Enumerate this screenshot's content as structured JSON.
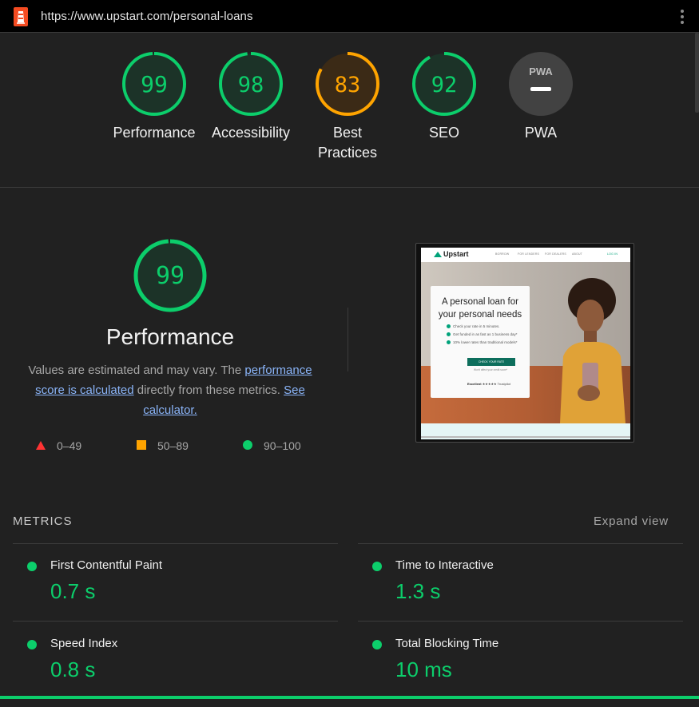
{
  "browser": {
    "url": "https://www.upstart.com/personal-loans",
    "menu_icon": "kebab-menu-icon",
    "logo_icon": "lighthouse-icon"
  },
  "colors": {
    "pass": "#0cce6b",
    "average": "#ffa400",
    "fail": "#ff3333",
    "background": "#212121",
    "link": "#8ab4f8"
  },
  "gauges": [
    {
      "score": 99,
      "label": "Performance",
      "status": "pass"
    },
    {
      "score": 98,
      "label": "Accessibility",
      "status": "pass"
    },
    {
      "score": 83,
      "label": "Best Practices",
      "status": "average"
    },
    {
      "score": 92,
      "label": "SEO",
      "status": "pass"
    },
    {
      "score": "PWA",
      "label": "PWA",
      "status": "na"
    }
  ],
  "performance": {
    "score": 99,
    "title": "Performance",
    "desc_pre": "Values are estimated and may vary. The ",
    "desc_link1": "performance score is calculated",
    "desc_mid": " directly from these metrics. ",
    "desc_link2": "See calculator."
  },
  "legend": [
    {
      "range": "0–49",
      "shape": "triangle",
      "color": "#ff3333"
    },
    {
      "range": "50–89",
      "shape": "square",
      "color": "#ffa400"
    },
    {
      "range": "90–100",
      "shape": "circle",
      "color": "#0cce6b"
    }
  ],
  "screenshot": {
    "brand": "Upstart",
    "nav_links": [
      "BORROW",
      "FOR LENDERS",
      "FOR DEALERS",
      "ABOUT",
      "LOG IN"
    ],
    "headline": "A personal loan for your personal needs",
    "bullets": [
      "Check your rate in 5 minutes.",
      "Get funded in as fast as 1 business day*",
      "10% lower rates than traditional models*"
    ],
    "button": "CHECK YOUR RATE",
    "note": "Won't affect your credit score*",
    "rating_label": "Excellent",
    "rating_brand": "Trustpilot"
  },
  "metrics": {
    "title": "METRICS",
    "expand_label": "Expand view",
    "items": [
      {
        "name": "First Contentful Paint",
        "value": "0.7 s",
        "status": "pass"
      },
      {
        "name": "Time to Interactive",
        "value": "1.3 s",
        "status": "pass"
      },
      {
        "name": "Speed Index",
        "value": "0.8 s",
        "status": "pass"
      },
      {
        "name": "Total Blocking Time",
        "value": "10 ms",
        "status": "pass"
      }
    ]
  }
}
